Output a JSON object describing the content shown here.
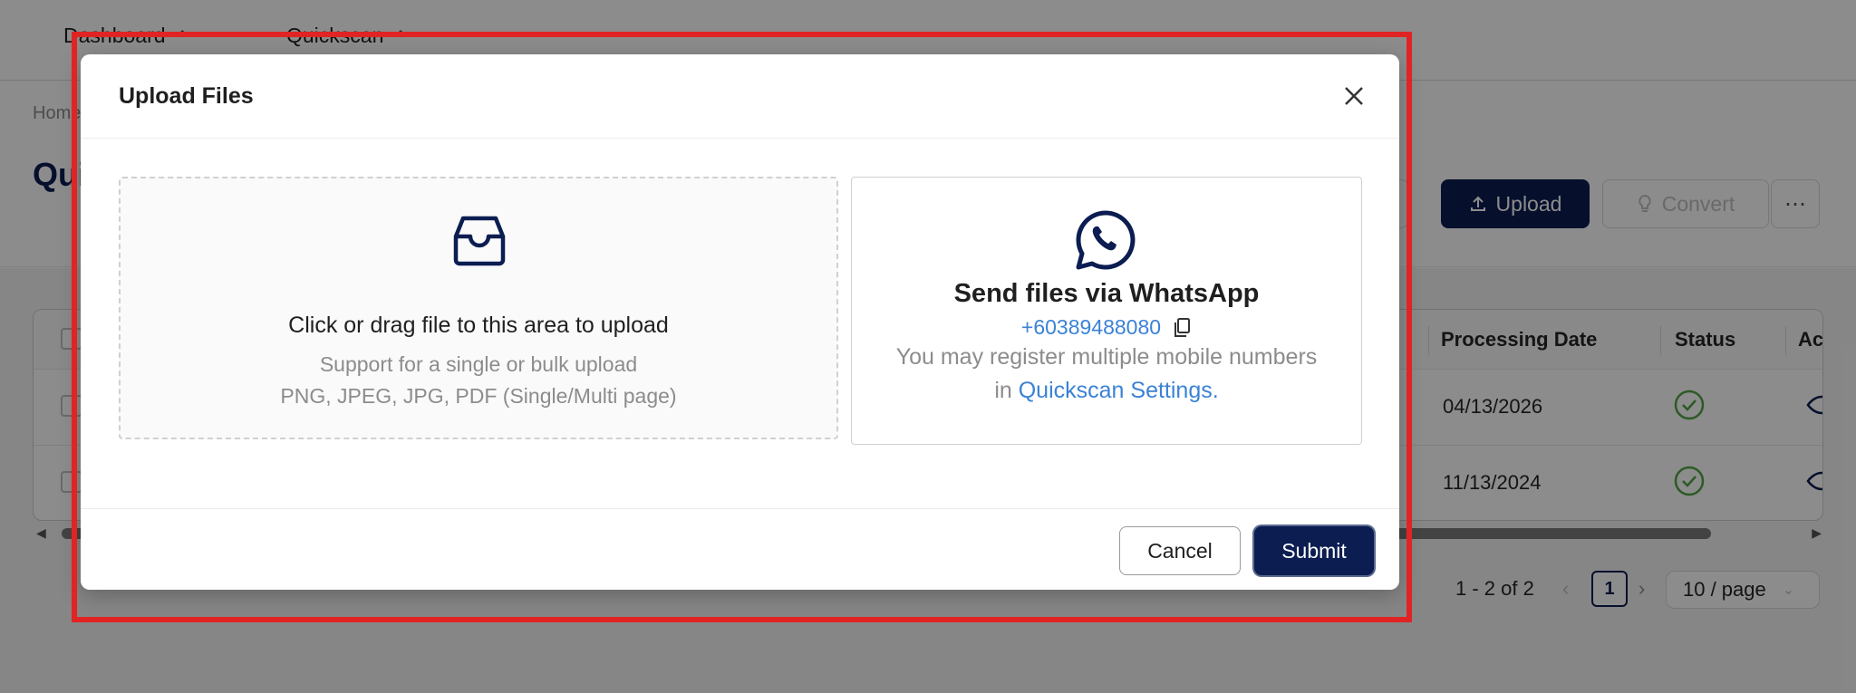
{
  "tabs": [
    {
      "label": "Dashboard"
    },
    {
      "label": "Quickscan"
    }
  ],
  "breadcrumb": "Home",
  "page_title": "Quickscan",
  "toolbar": {
    "upload_label": "Upload",
    "convert_label": "Convert",
    "more_label": "⋯"
  },
  "table": {
    "columns": [
      "Processing Date",
      "Status",
      "Ac"
    ],
    "rows": [
      {
        "processing_date": "04/13/2026",
        "status": "complete"
      },
      {
        "processing_date": "11/13/2024",
        "status": "complete"
      }
    ]
  },
  "pagination": {
    "range": "1 - 2 of 2",
    "current_page": "1",
    "page_size": "10 / page"
  },
  "modal": {
    "title": "Upload Files",
    "dropzone": {
      "main_text": "Click or drag file to this area to upload",
      "hint_line1": "Support for a single or bulk upload",
      "hint_line2": "PNG, JPEG, JPG, PDF (Single/Multi page)"
    },
    "whatsapp": {
      "title": "Send files via WhatsApp",
      "phone": "+60389488080",
      "note_line1": "You may register multiple mobile numbers",
      "note_prefix": "in ",
      "note_link": "Quickscan Settings."
    },
    "cancel_label": "Cancel",
    "submit_label": "Submit"
  },
  "colors": {
    "brand_navy": "#0b1d51",
    "link_blue": "#3b82d6",
    "status_green": "#52a444",
    "highlight_red": "#e02424"
  }
}
